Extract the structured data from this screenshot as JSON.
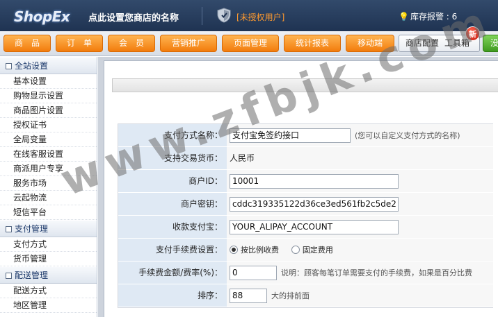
{
  "header": {
    "logo_text": "ShopEx",
    "shop_name": "点此设置您商店的名称",
    "license_status": "[未授权用户]",
    "stock_alert": "库存报警 : 6"
  },
  "nav": {
    "items": [
      "商　品",
      "订　单",
      "会　员",
      "营销推广",
      "页面管理",
      "统计报表",
      "移动端"
    ],
    "store_config": "商店配置",
    "toolbox": "工具箱",
    "new_badge": "新",
    "extra": "没"
  },
  "sidebar": {
    "groups": [
      {
        "title": "全站设置",
        "items": [
          "基本设置",
          "购物显示设置",
          "商品图片设置",
          "授权证书",
          "全局变量",
          "在线客服设置",
          "商派用户专享",
          "服务市场",
          "云起物流",
          "短信平台"
        ]
      },
      {
        "title": "支付管理",
        "items": [
          "支付方式",
          "货币管理"
        ]
      },
      {
        "title": "配送管理",
        "items": [
          "配送方式",
          "地区管理"
        ]
      }
    ]
  },
  "form": {
    "pay_name_label": "支付方式名称：",
    "pay_name_value": "支付宝免签约接口",
    "pay_name_hint": "(您可以自定义支付方式的名称)",
    "currency_label": "支持交易货币：",
    "currency_value": "人民币",
    "merchant_id_label": "商户ID：",
    "merchant_id_value": "10001",
    "merchant_key_label": "商户密钥：",
    "merchant_key_value": "cddc319335122d36ce3ed561fb2c5de2",
    "account_label": "收款支付宝：",
    "account_value": "YOUR_ALIPAY_ACCOUNT",
    "fee_setting_label": "支付手续费设置：",
    "fee_option_ratio": "按比例收费",
    "fee_option_fixed": "固定费用",
    "fee_amount_label": "手续费金额/费率(%)：",
    "fee_amount_value": "0",
    "fee_amount_hint": "说明：顾客每笔订单需要支付的手续费，如果是百分比费",
    "order_label": "排序：",
    "order_value": "88",
    "order_hint": "大的排前面"
  },
  "watermark": "www.zfbjk.com",
  "colors": {
    "header_bg": "#27405f",
    "nav_orange": "#f5891a",
    "unauth": "#ff9a2e",
    "label_bg": "#dfe9f4"
  }
}
